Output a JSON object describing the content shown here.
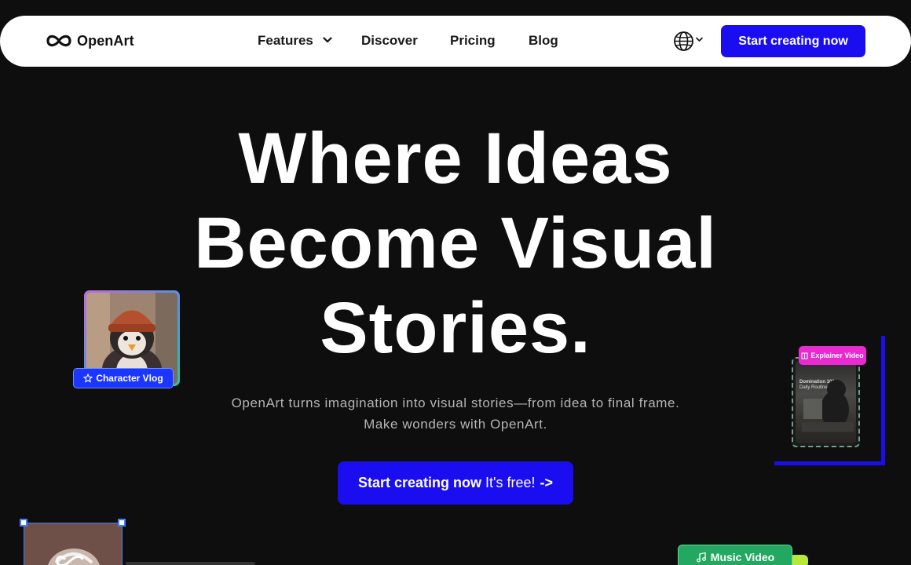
{
  "brand": {
    "name": "OpenArt"
  },
  "nav": {
    "items": [
      {
        "label": "Features"
      },
      {
        "label": "Discover"
      },
      {
        "label": "Pricing"
      },
      {
        "label": "Blog"
      }
    ],
    "cta_label": "Start creating now",
    "language_icon": "globe-icon"
  },
  "hero": {
    "title_lines": [
      "Where Ideas",
      "Become Visual",
      "Stories."
    ],
    "subtitle_lines": [
      "OpenArt turns imagination into visual stories—from idea to final frame.",
      "Make wonders with OpenArt."
    ],
    "cta": {
      "bold": "Start creating now",
      "normal": "It's free!",
      "arrow": "->"
    }
  },
  "cards": {
    "character_vlog": {
      "label": "Character Vlog",
      "icon": "star-icon"
    },
    "explainer_video": {
      "label": "Explainer Video",
      "icon": "book-icon",
      "caption_line1": "Domination 101",
      "caption_line2": "Daily Routines"
    },
    "music_video": {
      "label": "Music Video",
      "icon": "music-note-icon"
    }
  },
  "colors": {
    "accent": "#1a0ef0",
    "background": "#0e0e0e",
    "explainer_badge": "#e82ad0",
    "music_badge": "#22a860"
  }
}
